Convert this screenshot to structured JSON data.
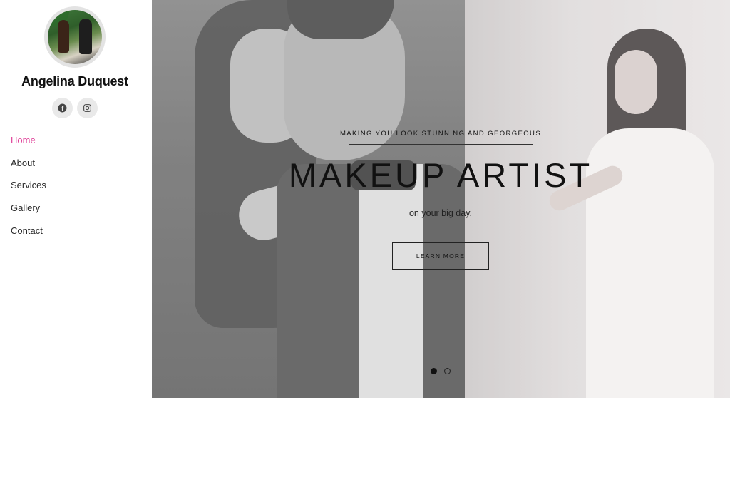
{
  "sidebar": {
    "brand_name": "Angelina Duquest",
    "avatar_icon": "avatar-photo",
    "socials": [
      {
        "icon": "facebook-icon"
      },
      {
        "icon": "instagram-icon"
      }
    ],
    "nav": [
      {
        "label": "Home",
        "active": true
      },
      {
        "label": "About",
        "active": false
      },
      {
        "label": "Services",
        "active": false
      },
      {
        "label": "Gallery",
        "active": false
      },
      {
        "label": "Contact",
        "active": false
      }
    ]
  },
  "hero": {
    "eyebrow": "MAKING YOU LOOK STUNNING AND GEORGEOUS",
    "headline": "MAKEUP ARTIST",
    "subline": "on your big day.",
    "cta_label": "LEARN MORE",
    "slides_total": 2,
    "active_slide": 1
  },
  "colors": {
    "accent": "#e0439a",
    "text": "#111111"
  }
}
